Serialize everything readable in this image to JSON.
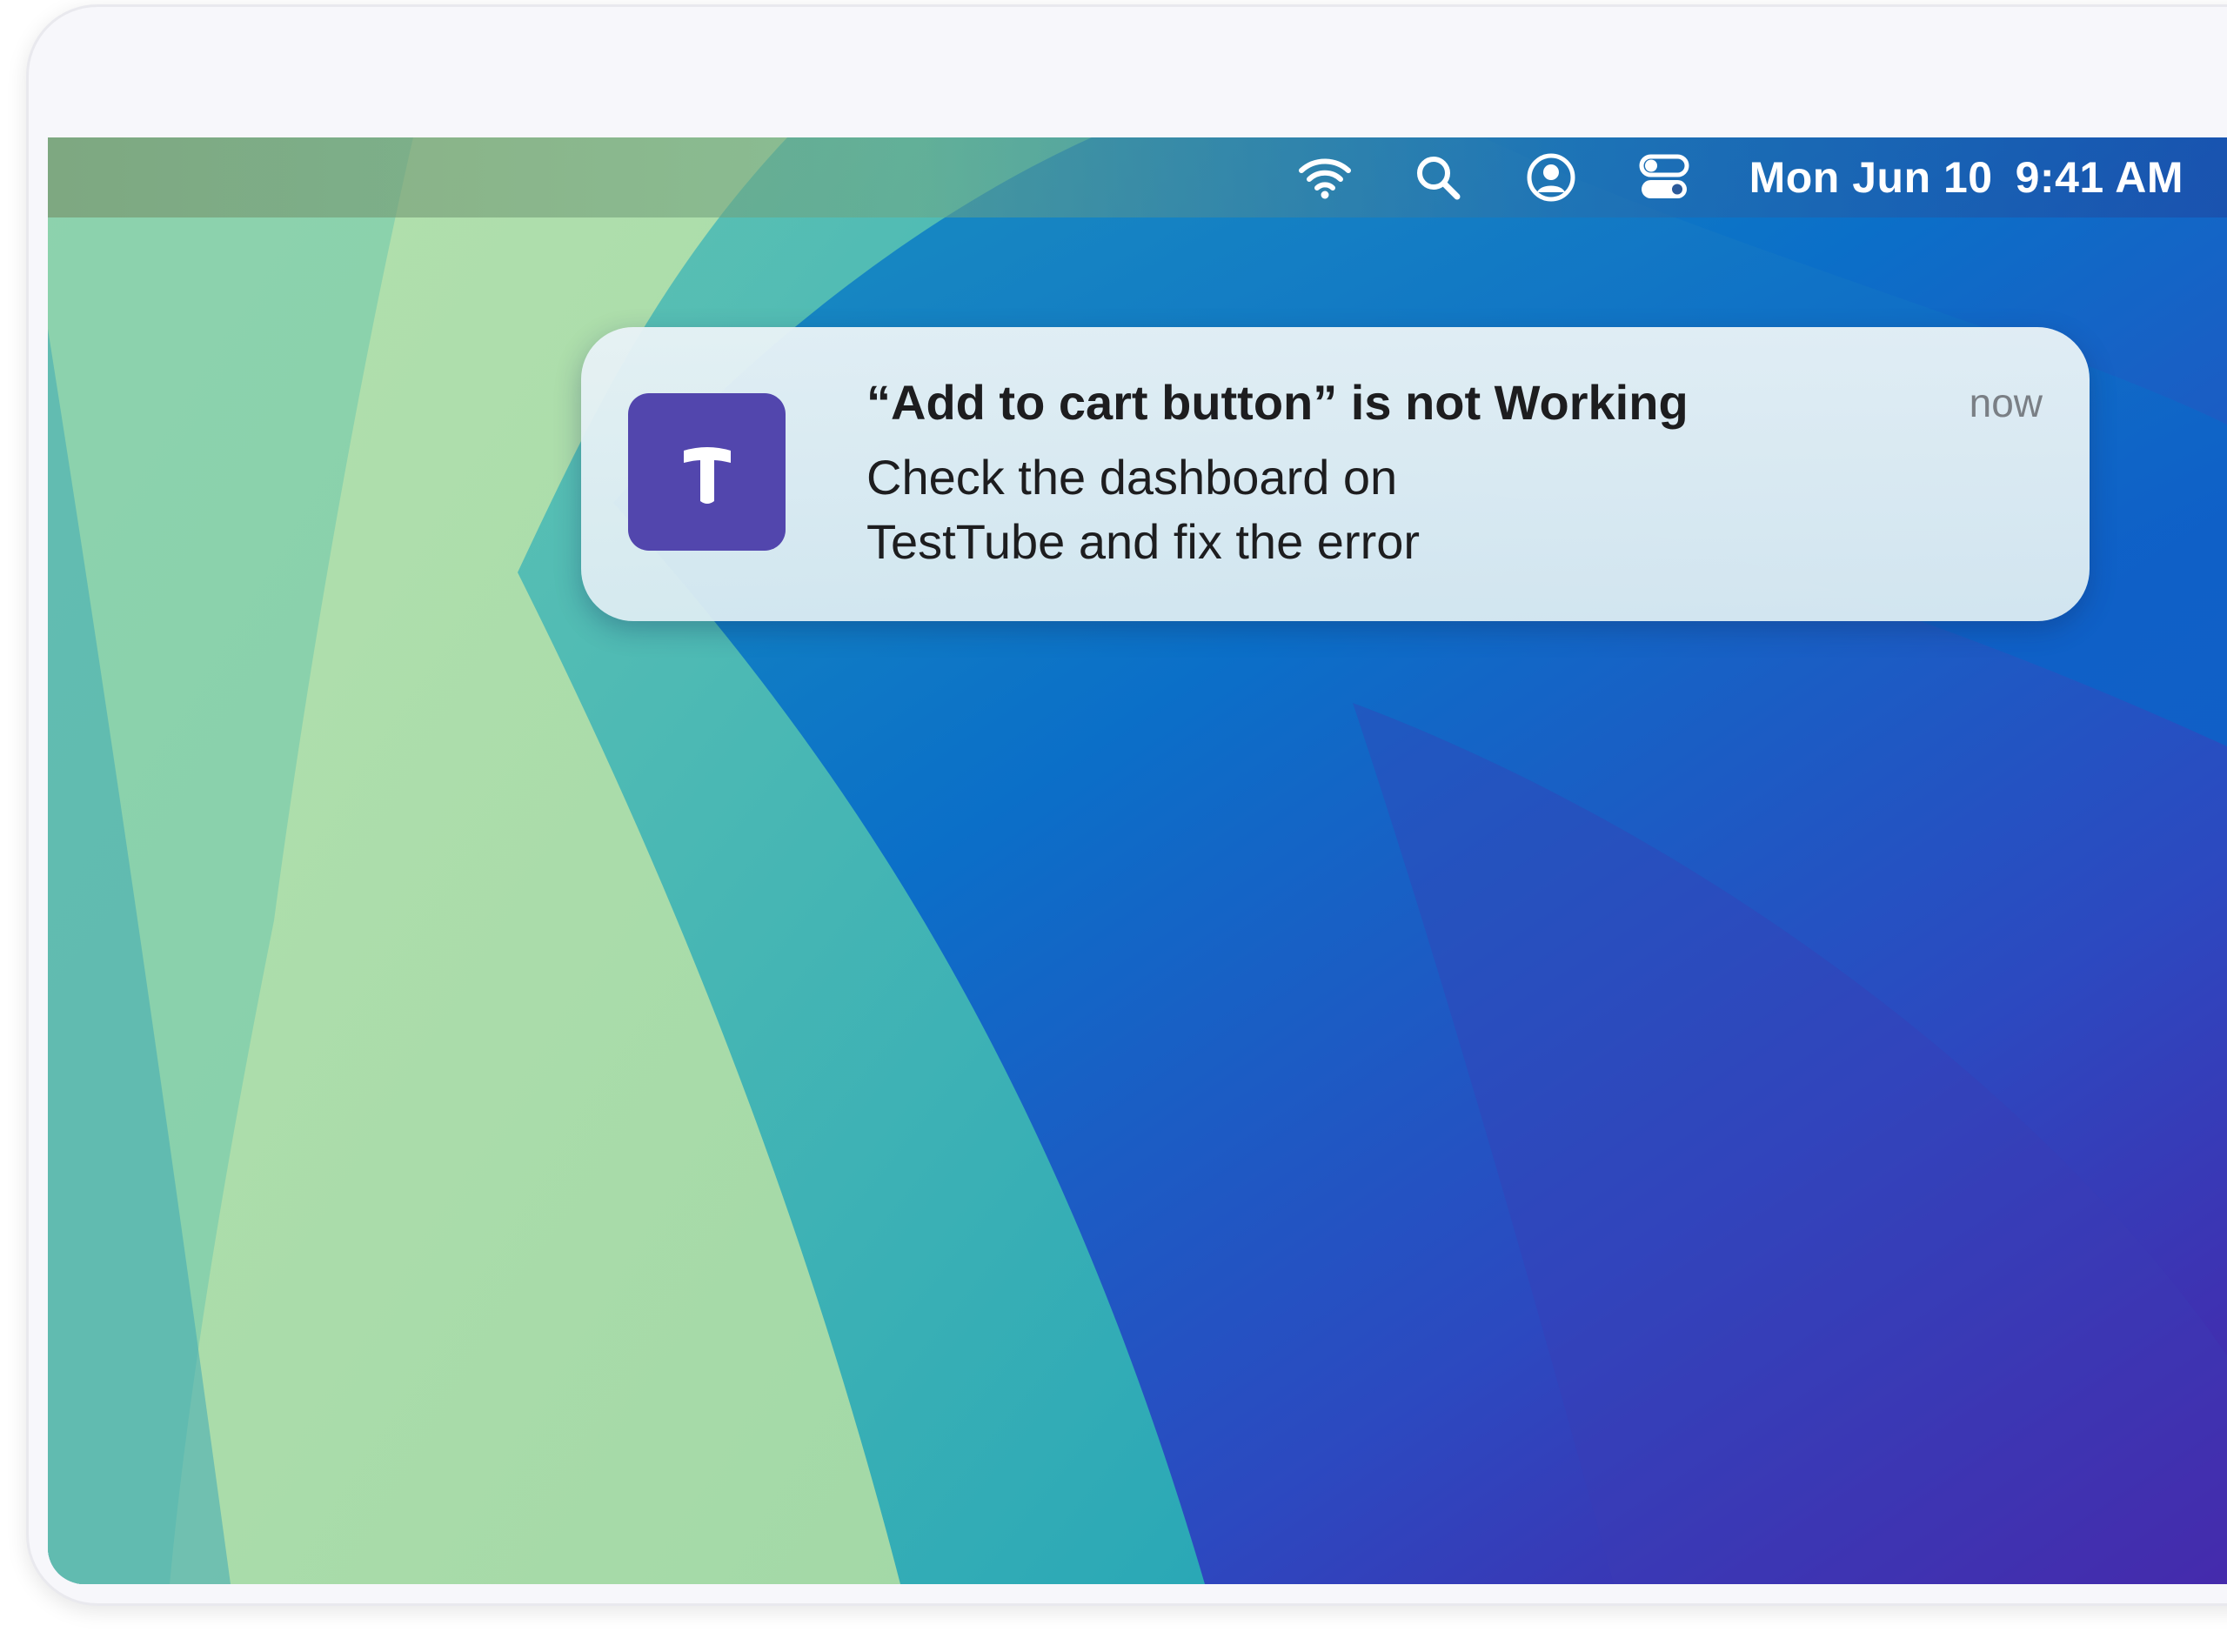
{
  "colors": {
    "app_icon_bg": "#5246ad",
    "text_primary": "#1d1d1f",
    "text_secondary": "#7a7f85"
  },
  "menubar": {
    "icons": [
      "wifi-icon",
      "search-icon",
      "user-account-icon",
      "control-center-icon"
    ],
    "date": "Mon Jun 10",
    "time": "9:41 AM"
  },
  "notification": {
    "app_icon_letter": "T",
    "title": "“Add to cart button” is not Working",
    "time": "now",
    "body_line1": "Check the dashboard on",
    "body_line2": "TestTube and fix the error"
  }
}
